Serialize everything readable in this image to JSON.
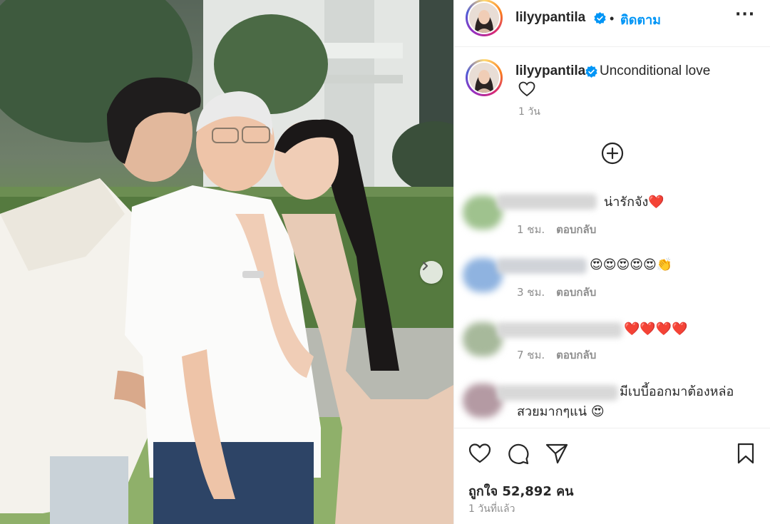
{
  "post": {
    "image_alt": "",
    "carousel_next_icon": "chevron-right-icon"
  },
  "header": {
    "username": "lilyypantila",
    "separator": "•",
    "follow_label": "ติดตาม",
    "more_icon": "more-horizontal-icon",
    "more_label": "···"
  },
  "caption": {
    "username": "lilyypantila",
    "text": "Unconditional love",
    "emoji": "heart-outline-icon",
    "time": "1 วัน"
  },
  "load_more_icon": "plus-circle-icon",
  "comments": [
    {
      "text": "น่ารักจัง",
      "emoji": "❤️",
      "time": "1 ชม.",
      "reply_label": "ตอบกลับ"
    },
    {
      "text": "",
      "emoji": "😍😍😍😍😍👏",
      "time": "3 ชม.",
      "reply_label": "ตอบกลับ"
    },
    {
      "text": "",
      "emoji": "❤️❤️❤️❤️",
      "time": "7 ชม.",
      "reply_label": "ตอบกลับ"
    },
    {
      "text": "มีเบบี้ออกมาต้องหล่อ",
      "text2": "สวยมากๆแน่",
      "emoji": "😍"
    }
  ],
  "actions": {
    "like_icon": "heart-icon",
    "comment_icon": "comment-icon",
    "share_icon": "send-icon",
    "save_icon": "bookmark-icon",
    "likes_text": "ถูกใจ 52,892 คน",
    "posted_ago": "1 วันที่แล้ว"
  },
  "colors": {
    "accent": "#0095f6",
    "like_red": "#ed4956",
    "muted": "#8e8e8e",
    "text": "#262626"
  }
}
